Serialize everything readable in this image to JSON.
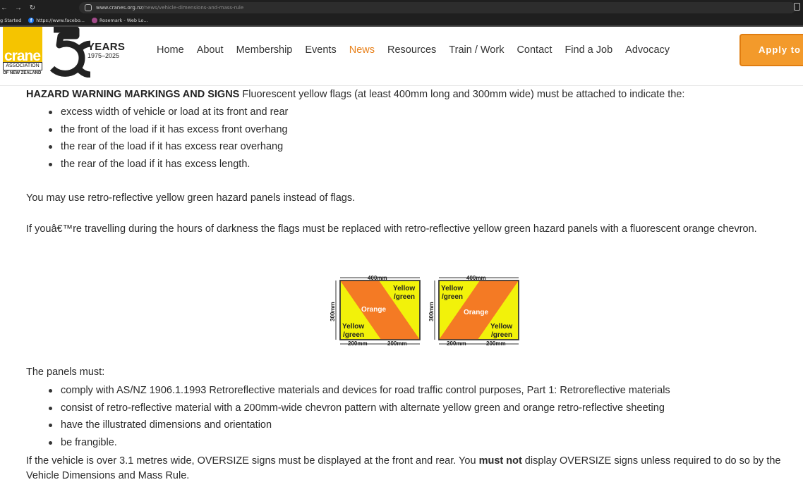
{
  "browser": {
    "url_domain": "www.cranes.org.nz",
    "url_path": "/news/vehicle-dimensions-and-mass-rule",
    "bookmarks": [
      {
        "label": "g Started"
      },
      {
        "label": "https://www.facebo..."
      },
      {
        "label": "Rosemark - Web Lo..."
      }
    ]
  },
  "header": {
    "logo": {
      "crane": "crane",
      "association": "ASSOCIATION",
      "country": "OF NEW ZEALAND",
      "years": "YEARS",
      "range": "1975–2025"
    },
    "nav": [
      {
        "label": "Home",
        "active": false
      },
      {
        "label": "About",
        "active": false
      },
      {
        "label": "Membership",
        "active": false
      },
      {
        "label": "Events",
        "active": false
      },
      {
        "label": "News",
        "active": true
      },
      {
        "label": "Resources",
        "active": false
      },
      {
        "label": "Train / Work",
        "active": false
      },
      {
        "label": "Contact",
        "active": false
      },
      {
        "label": "Find a Job",
        "active": false
      },
      {
        "label": "Advocacy",
        "active": false
      }
    ],
    "apply_label": "Apply to"
  },
  "article": {
    "hazard_heading": "HAZARD WARNING MARKINGS AND SIGNS",
    "hazard_text": " Fluorescent yellow flags (at least 400mm long and 300mm wide) must be attached to indicate the:",
    "flag_items": [
      "excess width of vehicle or load at its front and rear",
      "the front of the load if it has excess front overhang",
      "the rear of the load if it has excess rear overhang",
      "the rear of the load if it has excess length."
    ],
    "retro_note": "You may use retro-reflective yellow green hazard panels instead of flags.",
    "darkness_note": "If youâ€™re travelling during the hours of darkness the flags must be replaced with retro-reflective yellow green hazard panels with a fluorescent orange chevron.",
    "panels_intro": "The panels must:",
    "panel_items": [
      "comply with AS/NZ 1906.1.1993 Retroreflective materials and devices for road traffic control purposes, Part 1: Retroreflective materials",
      "consist of retro-reflective material with a 200mm-wide chevron pattern with alternate yellow green and orange retro-reflective sheeting",
      "have the illustrated dimensions and orientation",
      "be frangible."
    ],
    "oversize_part1": "If the vehicle is over 3.1 metres wide, OVERSIZE signs must be displayed at the front and rear. You ",
    "oversize_bold": "must not",
    "oversize_part2": " display OVERSIZE signs unless required to do so by the Vehicle Dimensions and Mass Rule."
  },
  "figure": {
    "width_label": "400mm",
    "height_label": "300mm",
    "half_label": "200mm",
    "orange_label": "Orange",
    "yellow_label": "Yellow",
    "green_label": "/green",
    "colors": {
      "yellow": "#f2f20a",
      "orange": "#f47a24",
      "outline": "#333333"
    }
  }
}
